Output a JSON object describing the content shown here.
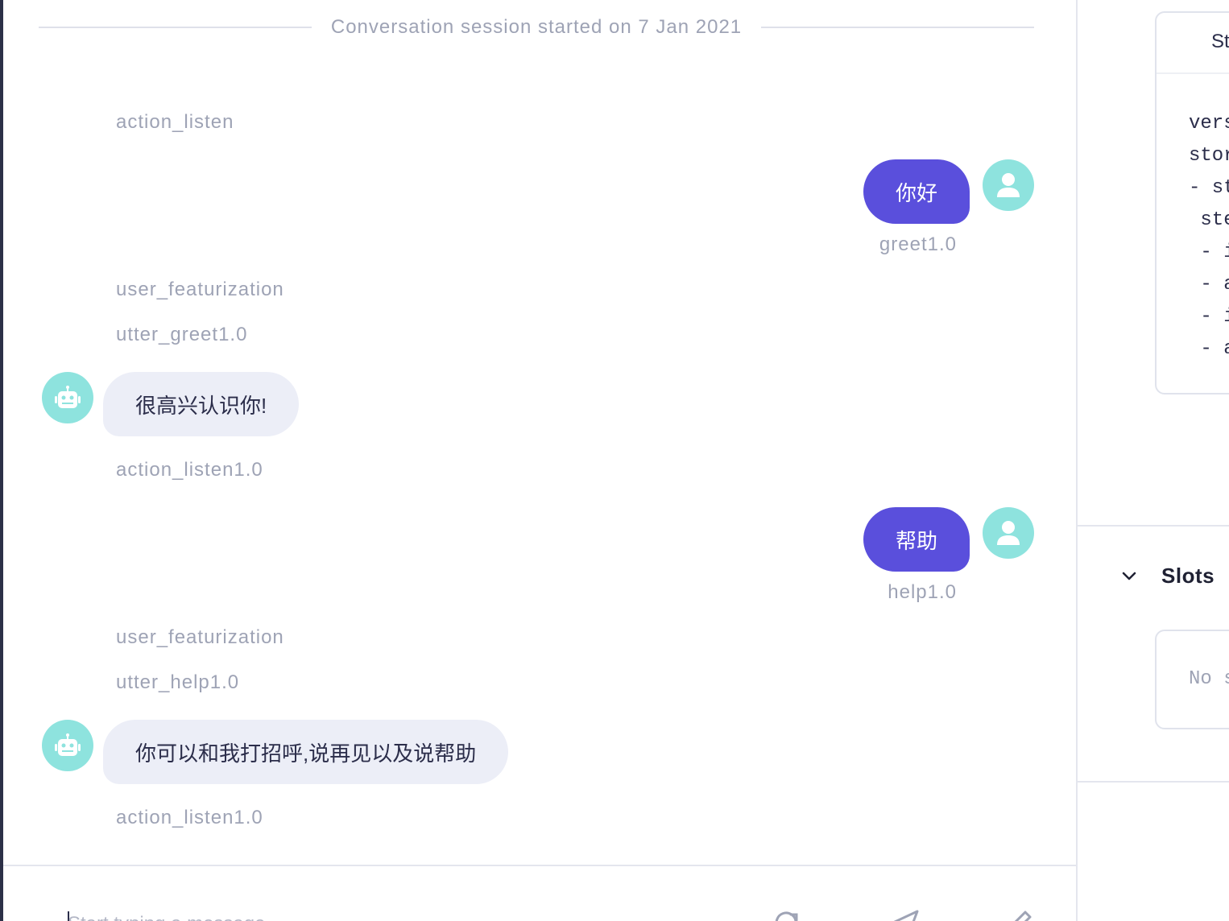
{
  "session": {
    "header": "Conversation session started on 7 Jan 2021"
  },
  "conversation": {
    "events": [
      {
        "kind": "action",
        "text": "action_listen"
      },
      {
        "kind": "user",
        "text": "你好",
        "intent": "greet1.0"
      },
      {
        "kind": "action",
        "text": "user_featurization"
      },
      {
        "kind": "action",
        "text": "utter_greet1.0"
      },
      {
        "kind": "bot",
        "text": "很高兴认识你!"
      },
      {
        "kind": "action",
        "text": "action_listen1.0"
      },
      {
        "kind": "user",
        "text": "帮助",
        "intent": "help1.0"
      },
      {
        "kind": "action",
        "text": "user_featurization"
      },
      {
        "kind": "action",
        "text": "utter_help1.0"
      },
      {
        "kind": "bot",
        "text": "你可以和我打招呼,说再见以及说帮助"
      },
      {
        "kind": "action",
        "text": "action_listen1.0"
      }
    ]
  },
  "composer": {
    "placeholder": "Start typing a message",
    "icons": [
      "restart-icon",
      "send-icon",
      "edit-icon"
    ]
  },
  "right_panel": {
    "story_tab_label": "St",
    "story_lines": [
      "vers",
      "stori",
      "- sto",
      " step",
      " - in",
      " - ac",
      " - in",
      " - ac"
    ],
    "slots_title": "Slots",
    "slots_empty": "No s"
  },
  "colors": {
    "user_bubble": "#5a4fdc",
    "bot_bubble": "#eceef7",
    "avatar": "#8ee3de",
    "muted_text": "#9ea3b5"
  }
}
